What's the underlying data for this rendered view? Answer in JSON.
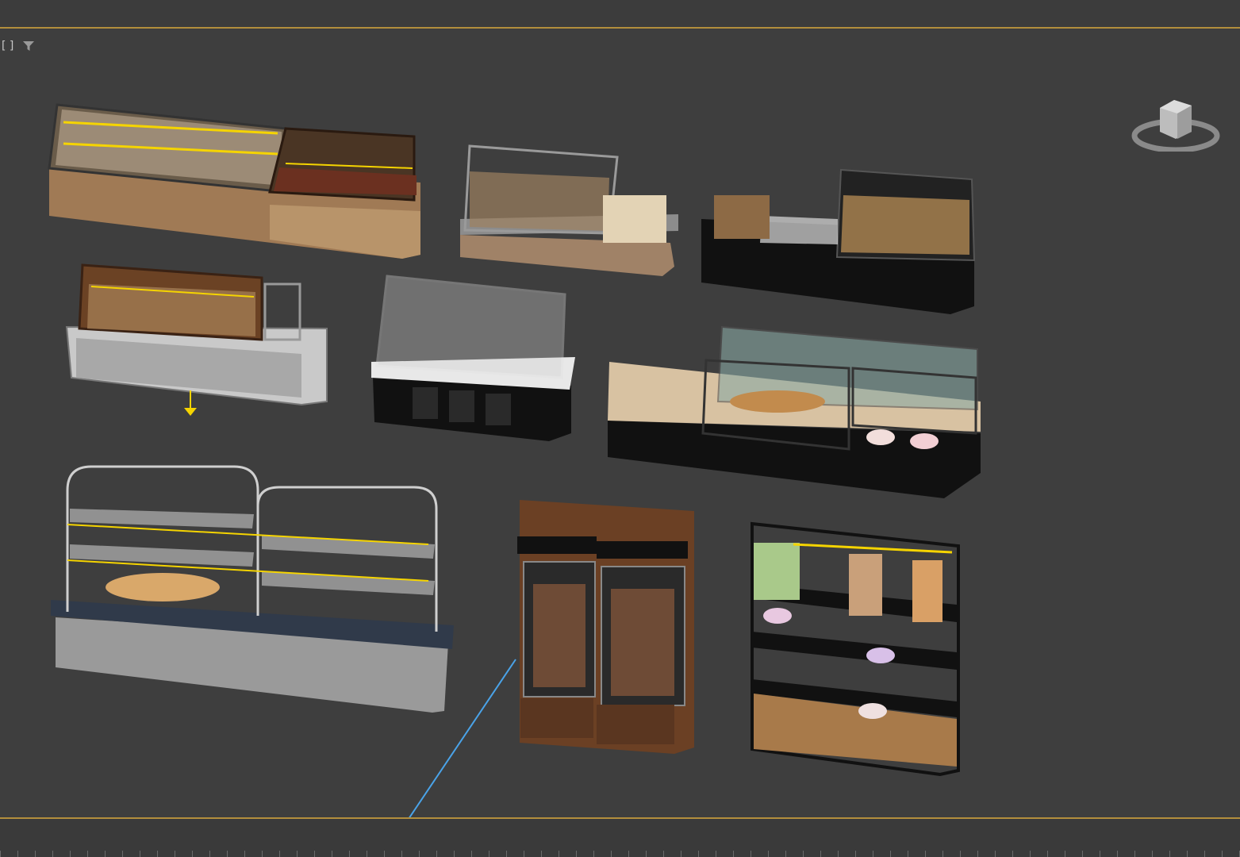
{
  "viewport": {
    "label": "[ ]",
    "filter_icon": "filter-icon",
    "viewcube_icon": "viewcube-icon"
  },
  "scene": {
    "objects": [
      "bakery-counter-curved-display",
      "glass-cabinet-bread-display",
      "black-counter-pastry-cage",
      "wooden-bakery-counter-with-baskets",
      "white-glass-display-counter",
      "cake-glass-showcase-counter",
      "open-shelving-bread-display",
      "wooden-refrigerated-cake-cabinet",
      "cake-shelving-unit-with-posters"
    ]
  },
  "colors": {
    "viewport_bg": "#3e3e3e",
    "frame_gold": "#b28e3c",
    "selection_yellow": "#f5d400",
    "grid_line_blue": "#4aa3e8"
  }
}
